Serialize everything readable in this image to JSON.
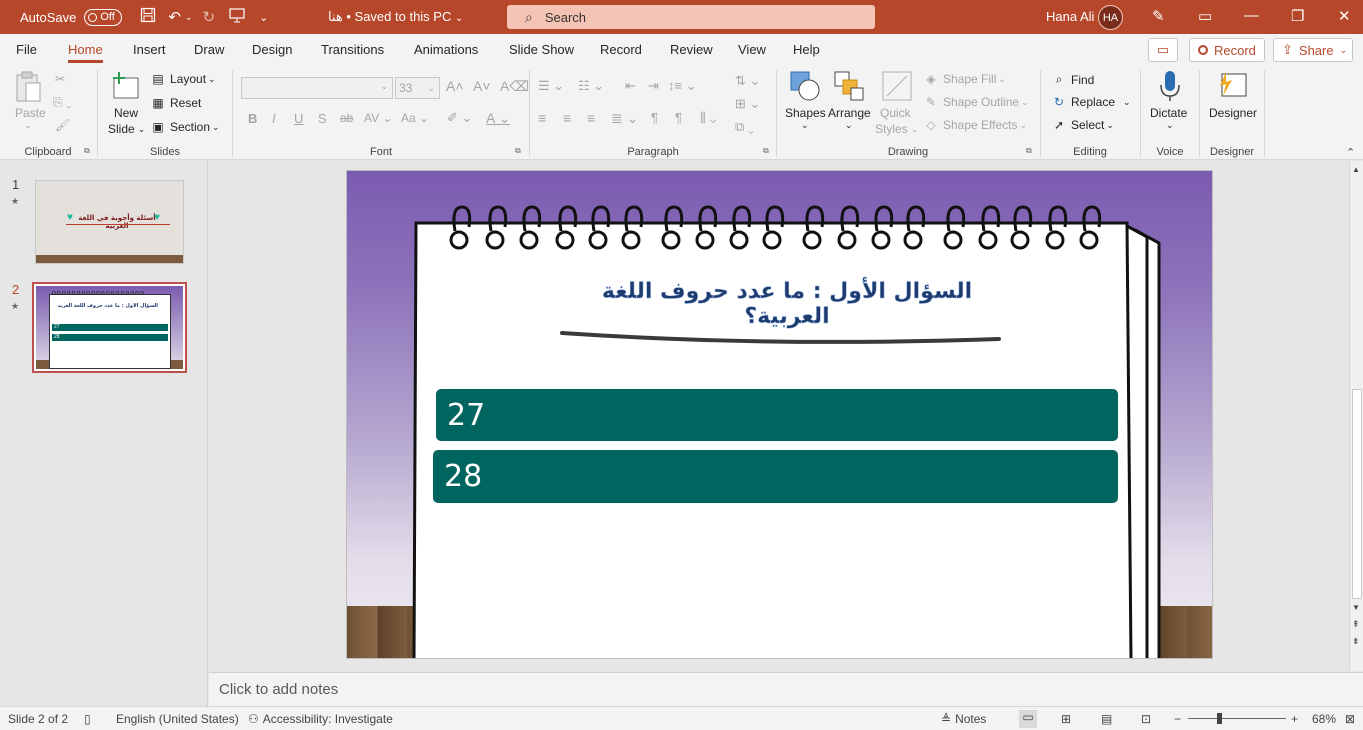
{
  "titlebar": {
    "autosave_label": "AutoSave",
    "autosave_state": "Off",
    "doc_title": "هنا • Saved to this PC",
    "search_placeholder": "Search",
    "user_name": "Hana Ali",
    "user_initials": "HA"
  },
  "menu": {
    "tabs": [
      "File",
      "Home",
      "Insert",
      "Draw",
      "Design",
      "Transitions",
      "Animations",
      "Slide Show",
      "Record",
      "Review",
      "View",
      "Help"
    ],
    "active_tab": "Home",
    "record_button": "Record",
    "share_button": "Share"
  },
  "ribbon": {
    "clipboard": {
      "label": "Clipboard",
      "paste": "Paste"
    },
    "slides": {
      "label": "Slides",
      "new_slide": "New",
      "new_slide2": "Slide",
      "layout": "Layout",
      "reset": "Reset",
      "section": "Section"
    },
    "font": {
      "label": "Font",
      "size": "33"
    },
    "paragraph": {
      "label": "Paragraph"
    },
    "drawing": {
      "label": "Drawing",
      "shapes": "Shapes",
      "arrange": "Arrange",
      "quick_styles": "Quick",
      "quick_styles2": "Styles",
      "shape_fill": "Shape Fill",
      "shape_outline": "Shape Outline",
      "shape_effects": "Shape Effects"
    },
    "editing": {
      "label": "Editing",
      "find": "Find",
      "replace": "Replace",
      "select": "Select"
    },
    "voice": {
      "label": "Voice",
      "dictate": "Dictate"
    },
    "designer": {
      "label": "Designer",
      "designer": "Designer"
    }
  },
  "thumbnails": [
    {
      "number": "1",
      "title": "أسئلة وأجوبة في اللغة العربية"
    },
    {
      "number": "2",
      "title": "السؤال الأول : ما عدد حروف اللغة العربية؟",
      "a1": "27",
      "a2": "28"
    }
  ],
  "slide": {
    "question": "السؤال الأول : ما عدد حروف اللغة العربية؟",
    "answers": [
      "27",
      "28"
    ]
  },
  "notes_placeholder": "Click to add notes",
  "status": {
    "slide_info": "Slide 2 of 2",
    "language": "English (United States)",
    "accessibility": "Accessibility: Investigate",
    "notes": "Notes",
    "zoom": "68%"
  },
  "colors": {
    "accent": "#b7472a",
    "answer_box": "#00655e",
    "slide_bg_top": "#7b5bb0"
  }
}
